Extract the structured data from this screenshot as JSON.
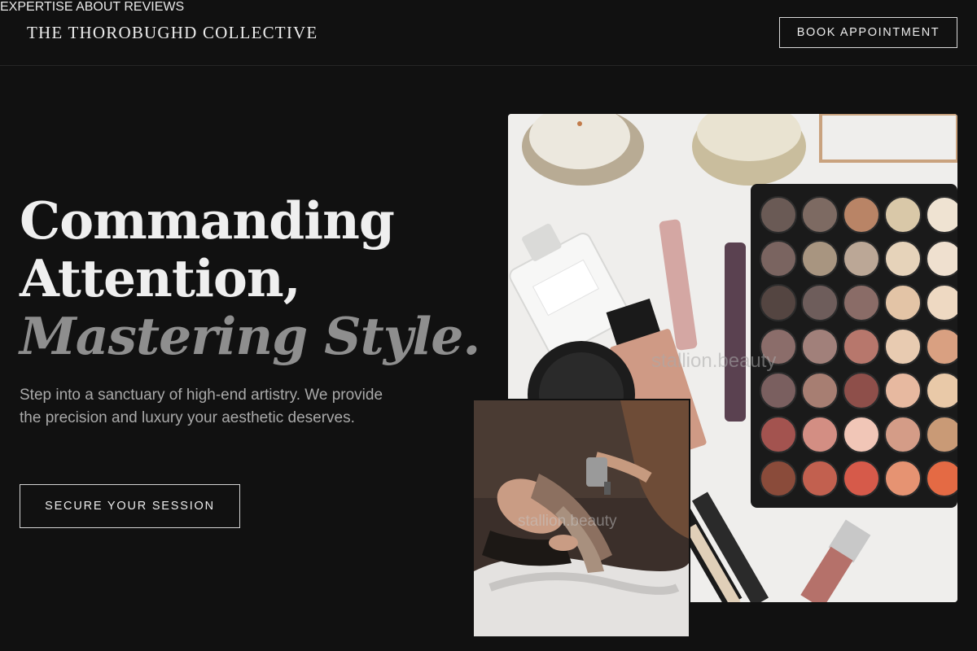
{
  "header": {
    "brand": "THE THOROBUGHD COLLECTIVE",
    "nav": [
      {
        "label": "EXPERTISE"
      },
      {
        "label": "ABOUT"
      },
      {
        "label": "REVIEWS"
      }
    ],
    "book_label": "BOOK APPOINTMENT"
  },
  "hero": {
    "line1": "Commanding",
    "line2": "Attention,",
    "line3": "Mastering Style.",
    "subtext": "Step into a sanctuary of high-end artistry. We provide the precision and luxury your aesthetic deserves.",
    "cta_label": "SECURE YOUR SESSION"
  },
  "images": {
    "main_watermark": "stallion.beauty",
    "inset_watermark": "stallion.beauty"
  },
  "colors": {
    "background": "#111111",
    "text": "#efefef",
    "muted": "#8e8e8e"
  }
}
